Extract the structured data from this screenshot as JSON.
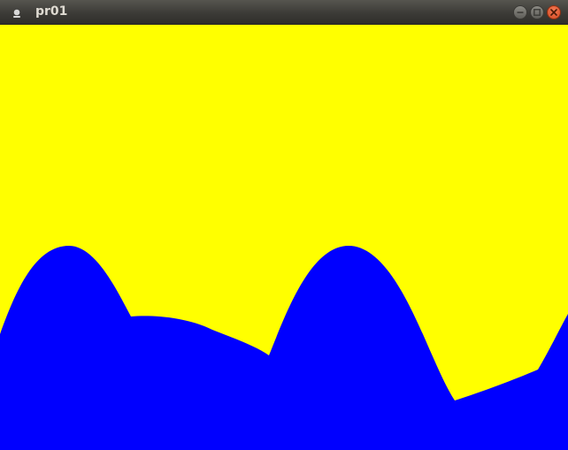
{
  "window": {
    "title": "pr01"
  },
  "icons": {
    "app": "app-icon",
    "minimize": "minimize-icon",
    "maximize": "maximize-icon",
    "close": "close-icon"
  },
  "colors": {
    "sky": "#ffff00",
    "terrain": "#0000ff",
    "titlebar": "#3c3b37",
    "close_button": "#e05a2e"
  }
}
